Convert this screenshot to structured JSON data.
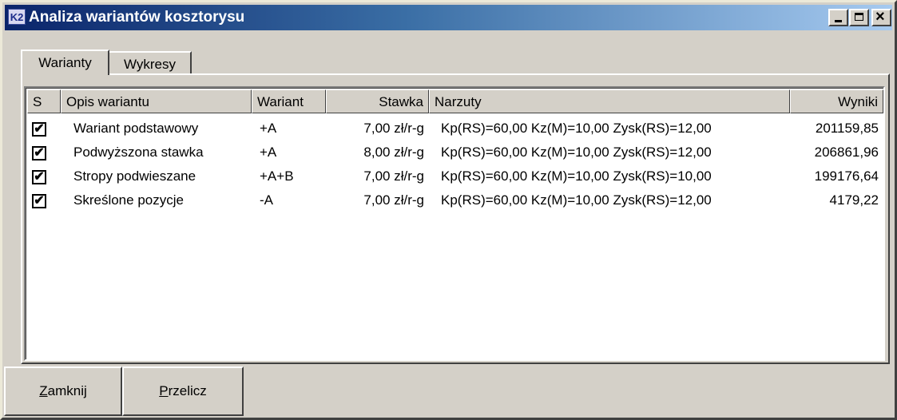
{
  "window": {
    "title": "Analiza wariantów kosztorysu",
    "icon": "K2"
  },
  "tabs": [
    {
      "label": "Warianty",
      "active": true
    },
    {
      "label": "Wykresy",
      "active": false
    }
  ],
  "columns": [
    "S",
    "Opis wariantu",
    "Wariant",
    "Stawka",
    "Narzuty",
    "Wyniki"
  ],
  "rows": [
    {
      "checked": "✔",
      "opis": "Wariant podstawowy",
      "wariant": "+A",
      "stawka": "7,00 zł/r-g",
      "narzuty": "Kp(RS)=60,00 Kz(M)=10,00 Zysk(RS)=12,00",
      "wyniki": "201159,85"
    },
    {
      "checked": "✔",
      "opis": "Podwyższona stawka",
      "wariant": "+A",
      "stawka": "8,00 zł/r-g",
      "narzuty": "Kp(RS)=60,00 Kz(M)=10,00 Zysk(RS)=12,00",
      "wyniki": "206861,96"
    },
    {
      "checked": "✔",
      "opis": "Stropy podwieszane",
      "wariant": "+A+B",
      "stawka": "7,00 zł/r-g",
      "narzuty": "Kp(RS)=60,00 Kz(M)=10,00 Zysk(RS)=10,00",
      "wyniki": "199176,64"
    },
    {
      "checked": "✔",
      "opis": "Skreślone pozycje",
      "wariant": "-A",
      "stawka": "7,00 zł/r-g",
      "narzuty": "Kp(RS)=60,00 Kz(M)=10,00 Zysk(RS)=12,00",
      "wyniki": "4179,22"
    }
  ],
  "buttons": {
    "close": {
      "mnemonic": "Z",
      "rest": "amknij"
    },
    "recalc": {
      "mnemonic": "P",
      "rest": "rzelicz"
    }
  },
  "caption": {
    "minimize": "_",
    "maximize": "□",
    "close": "×"
  }
}
